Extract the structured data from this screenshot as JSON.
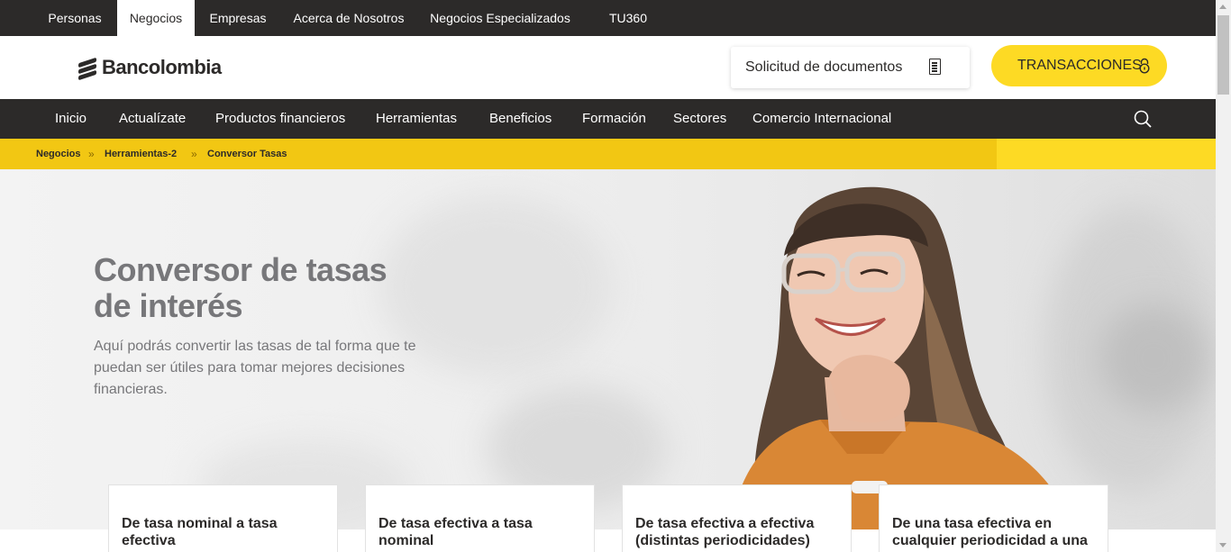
{
  "top_tabs": [
    "Personas",
    "Negocios",
    "Empresas",
    "Acerca de Nosotros",
    "Negocios Especializados",
    "TU360"
  ],
  "active_top_tab": "Negocios",
  "brand": {
    "name": "Bancolombia",
    "yellow": "#fdda24",
    "dark": "#2c2a29"
  },
  "header": {
    "docs_button": "Solicitud de documentos",
    "docs_icon": "document-list-icon",
    "transactions_button": "TRANSACCIONES",
    "transactions_icon": "lock-icon"
  },
  "main_nav": [
    "Inicio",
    "Actualízate",
    "Productos financieros",
    "Herramientas",
    "Beneficios",
    "Formación",
    "Sectores",
    "Comercio Internacional"
  ],
  "search_icon": "search-icon",
  "breadcrumb": [
    "Negocios",
    "Herramientas-2",
    "Conversor Tasas"
  ],
  "breadcrumb_separator": "»",
  "hero": {
    "title": "Conversor de tasas de interés",
    "description": "Aquí podrás convertir las tasas de tal forma que te puedan ser útiles para tomar mejores decisiones financieras."
  },
  "cards": [
    "De tasa nominal a tasa efectiva",
    "De tasa efectiva a tasa nominal",
    "De tasa efectiva a efectiva (distintas periodicidades)",
    "De una tasa efectiva en cualquier periodicidad a una"
  ]
}
